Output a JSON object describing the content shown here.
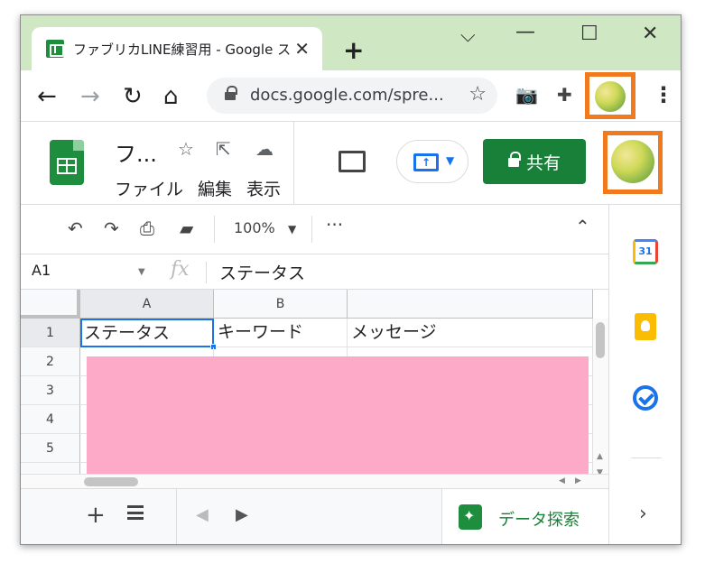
{
  "browser": {
    "tab_title": "ファブリカLINE練習用 - Google ス",
    "url": "docs.google.com/spre..."
  },
  "doc": {
    "title": "フ...",
    "menu": [
      "ファイル",
      "編集",
      "表示"
    ],
    "share_label": "共有"
  },
  "toolbar": {
    "zoom": "100%"
  },
  "formula": {
    "cell_ref": "A1",
    "fx_label": "fx",
    "value": "ステータス"
  },
  "sheet": {
    "columns": [
      "A",
      "B"
    ],
    "rows": [
      "1",
      "2",
      "3",
      "4",
      "5"
    ],
    "header_cells": [
      "ステータス",
      "キーワード",
      "メッセージ"
    ]
  },
  "side_panel": {
    "calendar_label": "31"
  },
  "bottom": {
    "explore_label": "データ探索"
  },
  "colors": {
    "titlebar": "#cfe8c3",
    "share": "#188038",
    "highlight": "#f07a1d",
    "redaction": "#fcaac8"
  }
}
